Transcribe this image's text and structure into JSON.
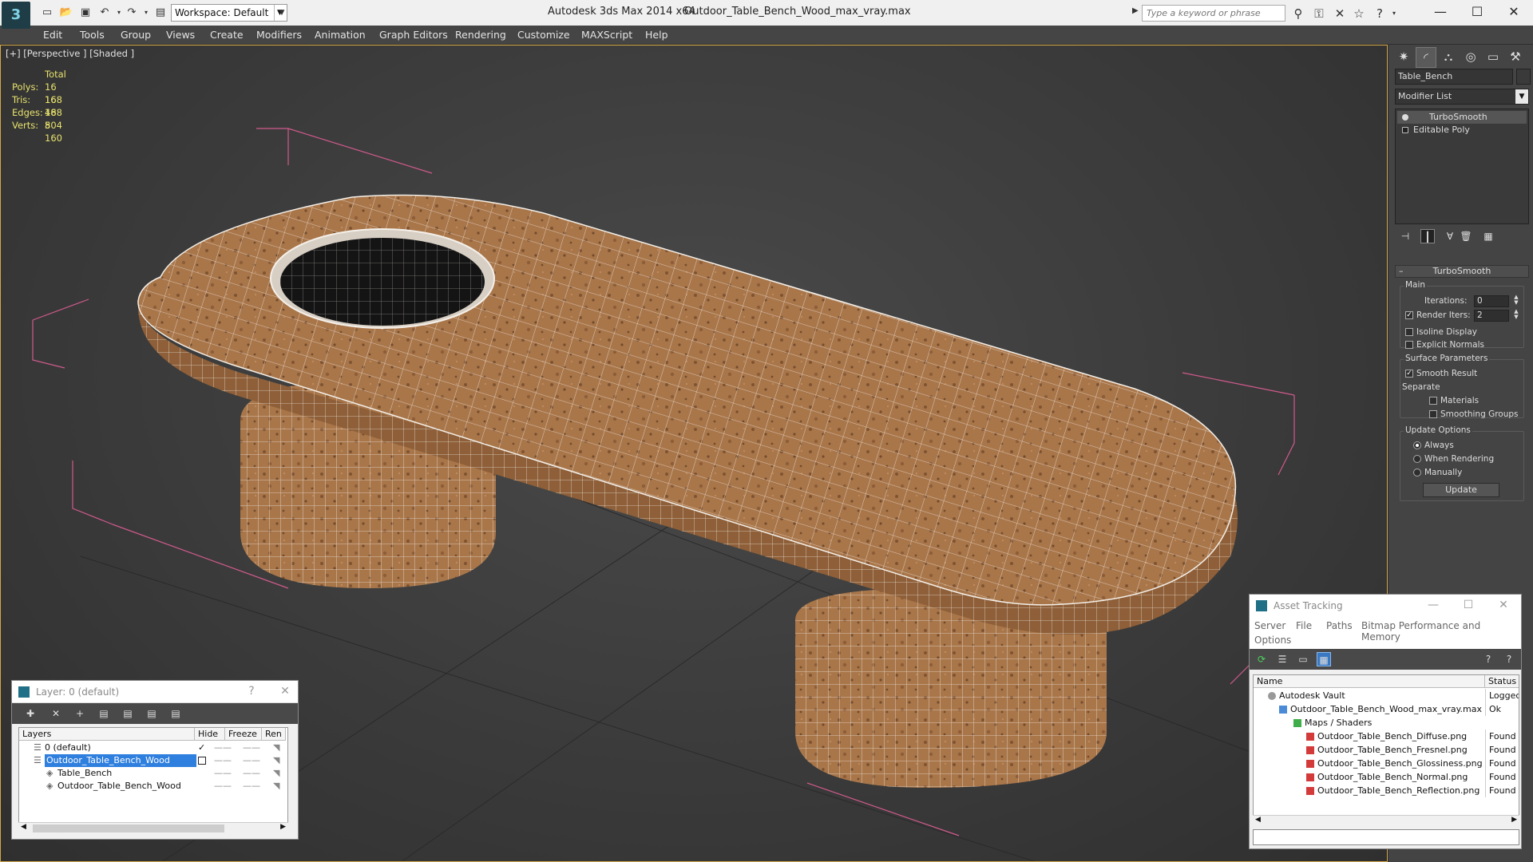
{
  "titlebar": {
    "app_title": "Autodesk 3ds Max  2014 x64",
    "file_name": "Outdoor_Table_Bench_Wood_max_vray.max",
    "workspace": "Workspace: Default",
    "search_placeholder": "Type a keyword or phrase"
  },
  "menu": [
    "Edit",
    "Tools",
    "Group",
    "Views",
    "Create",
    "Modifiers",
    "Animation",
    "Graph Editors",
    "Rendering",
    "Customize",
    "MAXScript",
    "Help"
  ],
  "viewport": {
    "label": "[+] [Perspective ] [Shaded ]",
    "stats": {
      "header": "Total",
      "rows": [
        {
          "key": "Polys:",
          "value": "16 168"
        },
        {
          "key": "Tris:",
          "value": "16 168"
        },
        {
          "key": "Edges:",
          "value": "48 504"
        },
        {
          "key": "Verts:",
          "value": "8 160"
        }
      ]
    },
    "colors": {
      "wood": "#a9764a",
      "bbox": "#d05a8c",
      "grid": "#2a2a2a"
    }
  },
  "command_panel": {
    "object_name": "Table_Bench",
    "modifier_list": "Modifier List",
    "stack": [
      "TurboSmooth",
      "Editable Poly"
    ],
    "turbosmooth": {
      "title": "TurboSmooth",
      "main": "Main",
      "iterations_label": "Iterations:",
      "iterations": "0",
      "render_iters_label": "Render Iters:",
      "render_iters": "2",
      "isoline": "Isoline Display",
      "explicit": "Explicit Normals",
      "surface": "Surface Parameters",
      "smooth_result": "Smooth Result",
      "separate": "Separate",
      "materials": "Materials",
      "smoothing_groups": "Smoothing Groups",
      "update_options": "Update Options",
      "always": "Always",
      "when_rendering": "When Rendering",
      "manually": "Manually",
      "update_btn": "Update"
    }
  },
  "layer_dialog": {
    "title": "Layer: 0 (default)",
    "help": "?",
    "headers": [
      "Layers",
      "Hide",
      "Freeze",
      "Ren"
    ],
    "rows": [
      {
        "name": "0 (default)",
        "indent": 1,
        "selected": false,
        "check": true
      },
      {
        "name": "Outdoor_Table_Bench_Wood",
        "indent": 1,
        "selected": true,
        "check": false
      },
      {
        "name": "Table_Bench",
        "indent": 2,
        "selected": false,
        "check": false
      },
      {
        "name": "Outdoor_Table_Bench_Wood",
        "indent": 2,
        "selected": false,
        "check": false
      }
    ]
  },
  "asset_dialog": {
    "title": "Asset Tracking",
    "menu": [
      "Server",
      "File",
      "Paths",
      "Bitmap Performance and Memory",
      "Options"
    ],
    "headers": [
      "Name",
      "Status"
    ],
    "rows": [
      {
        "name": "Autodesk Vault",
        "status": "Logged",
        "indent": 0
      },
      {
        "name": "Outdoor_Table_Bench_Wood_max_vray.max",
        "status": "Ok",
        "indent": 1
      },
      {
        "name": "Maps / Shaders",
        "status": "",
        "indent": 2
      },
      {
        "name": "Outdoor_Table_Bench_Diffuse.png",
        "status": "Found",
        "indent": 3
      },
      {
        "name": "Outdoor_Table_Bench_Fresnel.png",
        "status": "Found",
        "indent": 3
      },
      {
        "name": "Outdoor_Table_Bench_Glossiness.png",
        "status": "Found",
        "indent": 3
      },
      {
        "name": "Outdoor_Table_Bench_Normal.png",
        "status": "Found",
        "indent": 3
      },
      {
        "name": "Outdoor_Table_Bench_Reflection.png",
        "status": "Found",
        "indent": 3
      }
    ]
  }
}
